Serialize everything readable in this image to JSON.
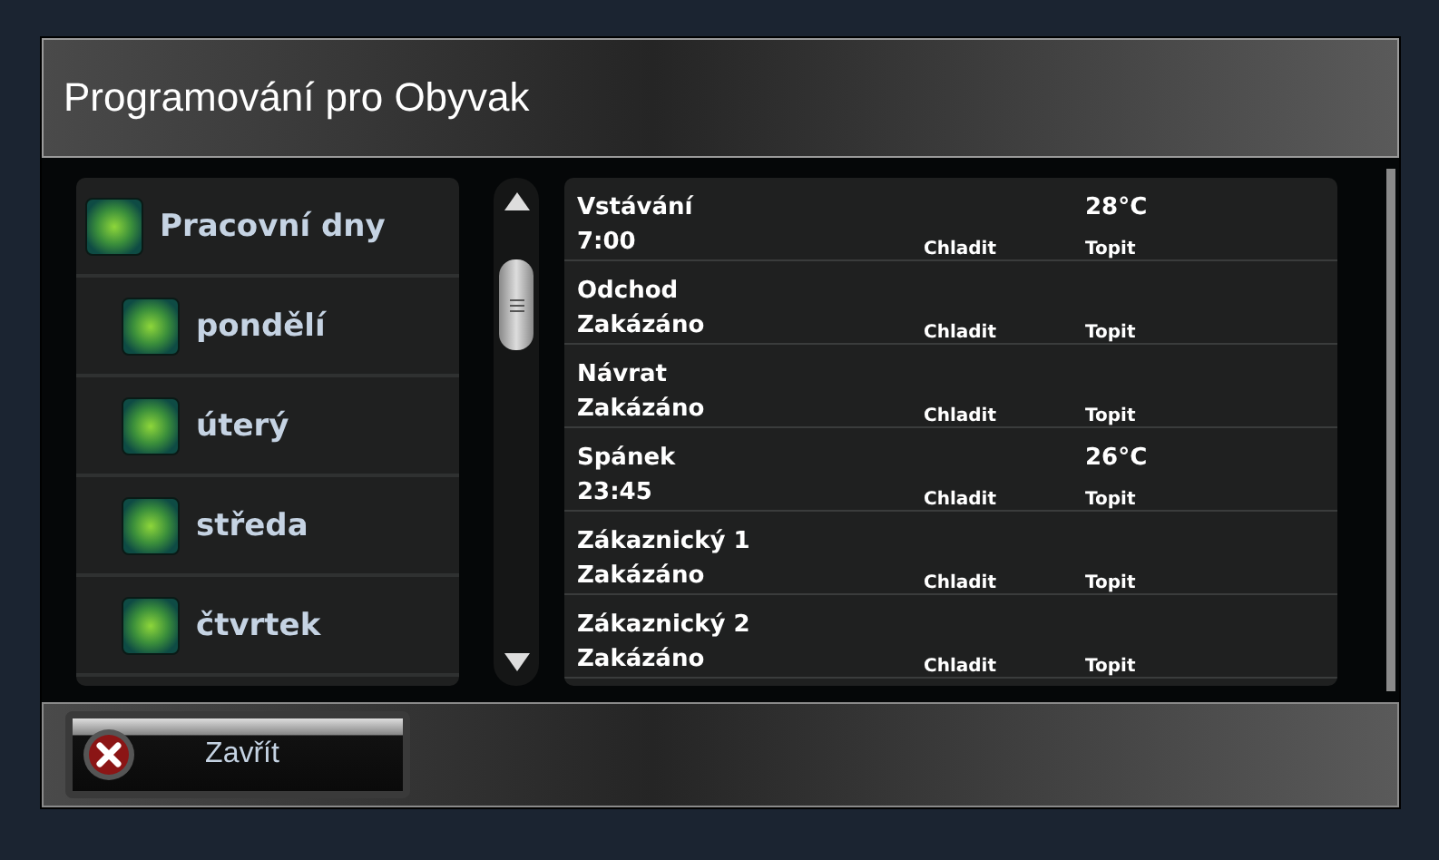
{
  "dialog": {
    "title": "Programování pro Obyvak"
  },
  "days": [
    {
      "label": "Pracovní dny",
      "checked": true,
      "children": [
        {
          "label": "pondělí",
          "checked": true
        },
        {
          "label": "úterý",
          "checked": true
        },
        {
          "label": "středa",
          "checked": true
        },
        {
          "label": "čtvrtek",
          "checked": true
        }
      ]
    }
  ],
  "schedule": [
    {
      "name": "Vstávání",
      "time": "7:00",
      "cool_label": "Chladit",
      "heat_temp": "28°C",
      "heat_label": "Topit"
    },
    {
      "name": "Odchod",
      "time": "Zakázáno",
      "cool_label": "Chladit",
      "heat_label": "Topit"
    },
    {
      "name": "Návrat",
      "time": "Zakázáno",
      "cool_label": "Chladit",
      "heat_label": "Topit"
    },
    {
      "name": "Spánek",
      "time": "23:45",
      "cool_label": "Chladit",
      "heat_temp": "26°C",
      "heat_label": "Topit"
    },
    {
      "name": "Zákaznický 1",
      "time": "Zakázáno",
      "cool_label": "Chladit",
      "heat_label": "Topit"
    },
    {
      "name": "Zákaznický 2",
      "time": "Zakázáno",
      "cool_label": "Chladit",
      "heat_label": "Topit"
    }
  ],
  "close_button": {
    "label": "Zavřít"
  }
}
